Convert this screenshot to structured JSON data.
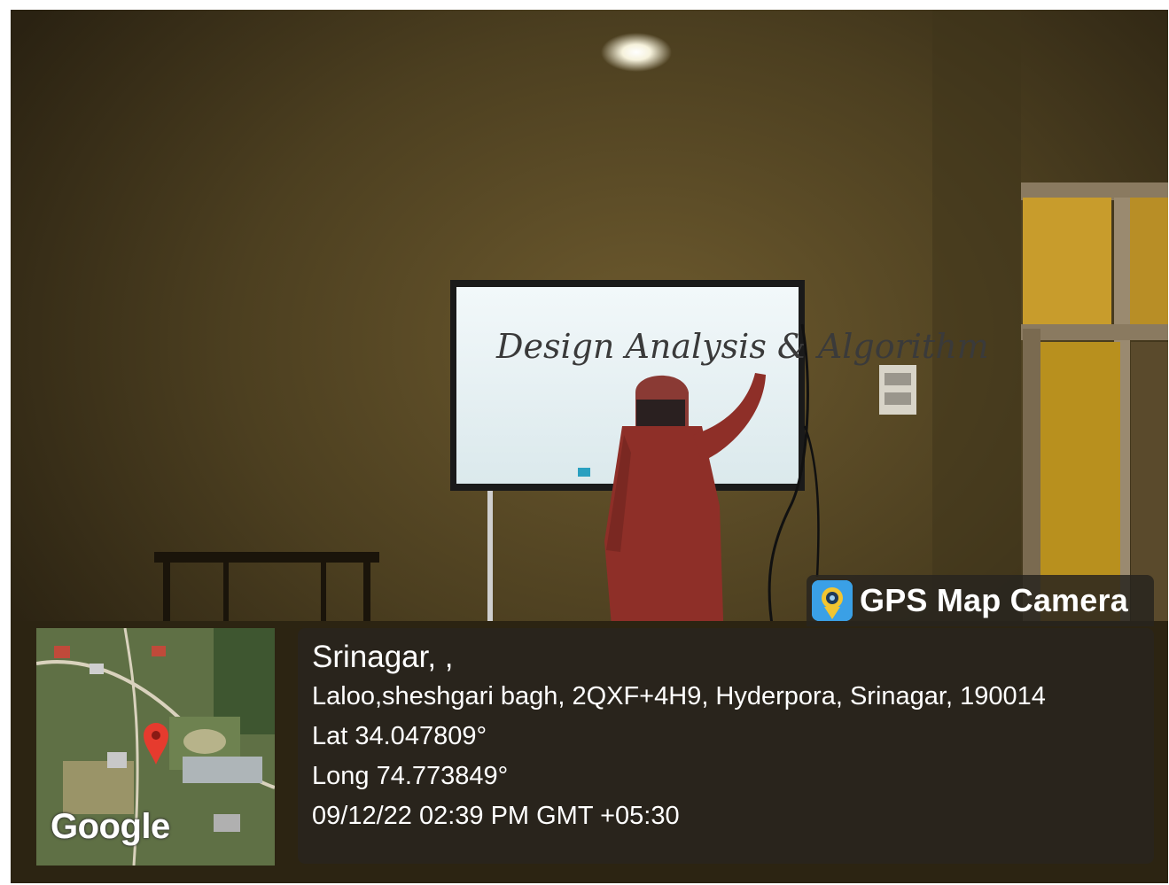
{
  "overlay": {
    "brand": "GPS Map Camera",
    "city": "Srinagar, ,",
    "address": "Laloo,sheshgari bagh, 2QXF+4H9, Hyderpora, Srinagar, 190014",
    "latitude": "Lat 34.047809°",
    "longitude": "Long 74.773849°",
    "datetime": "09/12/22 02:39 PM GMT +05:30"
  },
  "map": {
    "provider_logo": "Google",
    "marker_icon": "map-pin-icon"
  },
  "scene": {
    "whiteboard_text": "Design Analysis & Algorithm"
  },
  "colors": {
    "wall": "#5a4a26",
    "panel": "#28241e",
    "screen": "#e8f2f4",
    "marker": "#e63b2e"
  }
}
